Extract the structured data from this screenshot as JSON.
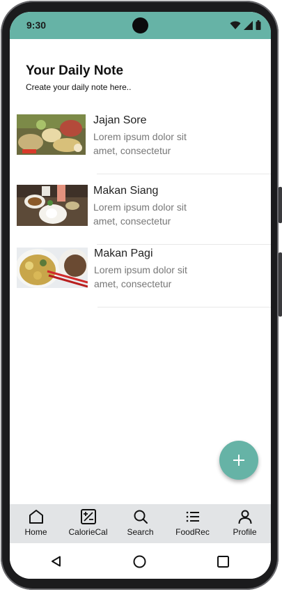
{
  "status_bar": {
    "time": "9:30"
  },
  "header": {
    "title": "Your Daily Note",
    "subtitle": "Create your daily note here.."
  },
  "notes": [
    {
      "title": "Jajan Sore",
      "desc": "Lorem ipsum dolor sit amet, consectetur"
    },
    {
      "title": "Makan Siang",
      "desc": "Lorem ipsum dolor sit amet, consectetur"
    },
    {
      "title": "Makan Pagi",
      "desc": "Lorem ipsum dolor sit amet, consectetur"
    }
  ],
  "fab": {
    "icon": "plus-icon"
  },
  "bottom_nav": {
    "items": [
      {
        "label": "Home",
        "icon": "home-icon"
      },
      {
        "label": "CalorieCal",
        "icon": "calculator-icon"
      },
      {
        "label": "Search",
        "icon": "search-icon"
      },
      {
        "label": "FoodRec",
        "icon": "list-icon"
      },
      {
        "label": "Profile",
        "icon": "profile-icon"
      }
    ]
  },
  "colors": {
    "accent": "#66b3a6",
    "nav_background": "#e2e4e6"
  }
}
